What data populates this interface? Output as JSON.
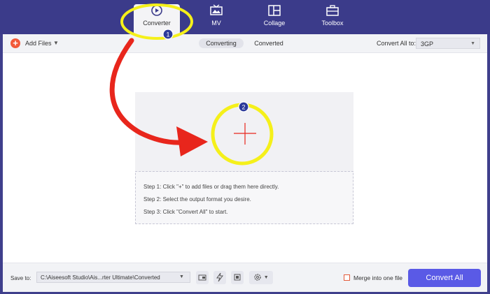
{
  "nav": {
    "items": [
      {
        "label": "Converter",
        "icon": "converter-icon"
      },
      {
        "label": "MV",
        "icon": "tv-icon"
      },
      {
        "label": "Collage",
        "icon": "collage-icon"
      },
      {
        "label": "Toolbox",
        "icon": "toolbox-icon"
      }
    ],
    "active": "Converter"
  },
  "toolbar": {
    "add_files_label": "Add Files",
    "tabs": [
      "Converting",
      "Converted"
    ],
    "active_tab": "Converting",
    "convert_all_to_label": "Convert All to:",
    "format_value": "3GP"
  },
  "dropzone": {
    "steps": [
      "Step 1: Click \"+\" to add files or drag them here directly.",
      "Step 2: Select the output format you desire.",
      "Step 3: Click \"Convert All\" to start."
    ]
  },
  "bottom": {
    "save_to_label": "Save to:",
    "path_value": "C:\\Aiseesoft Studio\\Ais...rter Ultimate\\Converted",
    "merge_label": "Merge into one file",
    "convert_all_label": "Convert All"
  },
  "annotations": {
    "badges": [
      "1",
      "2"
    ],
    "highlight_color": "#f5f01a",
    "arrow_color": "#e8261c"
  },
  "colors": {
    "topbar": "#3b3b8a",
    "accent": "#5a5ae6",
    "add_button": "#f25a3a"
  }
}
